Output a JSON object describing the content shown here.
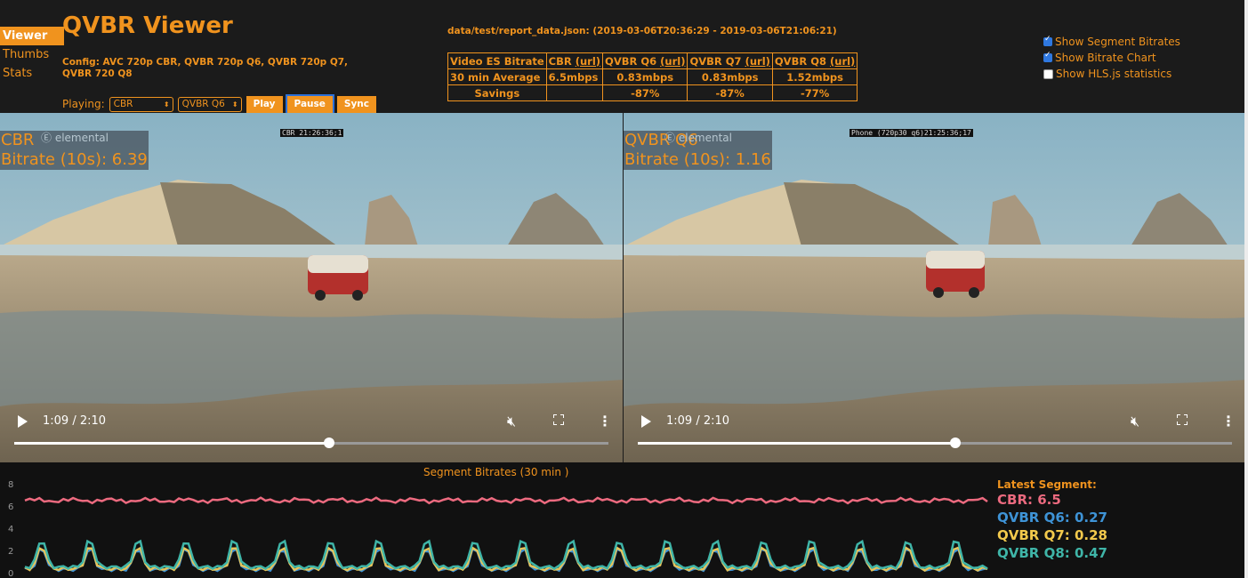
{
  "nav": {
    "items": [
      "Viewer",
      "Thumbs",
      "Stats"
    ],
    "active": 0
  },
  "app_title": "QVBR Viewer",
  "config": "Config: AVC 720p CBR, QVBR 720p Q6, QVBR 720p Q7, QVBR 720 Q8",
  "playing": {
    "label": "Playing:",
    "left_select": "CBR",
    "right_select": "QVBR Q6",
    "play": "Play",
    "pause": "Pause",
    "sync": "Sync"
  },
  "data_file": "data/test/report_data.json: (2019-03-06T20:36:29 - 2019-03-06T21:06:21)",
  "stats_table": {
    "header": [
      "Video ES Bitrate",
      "CBR",
      "QVBR Q6",
      "QVBR Q7",
      "QVBR Q8"
    ],
    "url_label": "(url)",
    "rows": [
      [
        "30 min Average",
        "6.5mbps",
        "0.83mbps",
        "0.83mbps",
        "1.52mbps"
      ],
      [
        "Savings",
        "",
        "-87%",
        "-87%",
        "-77%"
      ]
    ]
  },
  "checkboxes": [
    {
      "label": "Show Segment Bitrates",
      "checked": true
    },
    {
      "label": "Show Bitrate Chart",
      "checked": true
    },
    {
      "label": "Show HLS.js statistics",
      "checked": false
    }
  ],
  "players": [
    {
      "name": "CBR",
      "bitrate_label": "Bitrate (10s): 6.39",
      "watermark": "elemental",
      "timestamp": "CBR 21:26:36;1",
      "time": "1:09 / 2:10",
      "progress": 0.53
    },
    {
      "name": "QVBR Q6",
      "bitrate_label": "Bitrate (10s): 1.16",
      "watermark": "elemental",
      "timestamp": "Phone (720p30 q6)21:25:36;17",
      "time": "1:09 / 2:10",
      "progress": 0.535
    }
  ],
  "chart_data": {
    "type": "line",
    "title": "Segment Bitrates (30 min )",
    "xlabel": "",
    "ylabel": "",
    "ylim": [
      0,
      8
    ],
    "yticks": [
      0,
      2,
      4,
      6,
      8
    ],
    "series": [
      {
        "name": "CBR",
        "color": "#ec6a7f",
        "pattern": "flat",
        "base": 6.5,
        "amp": 0.25
      },
      {
        "name": "QVBR Q6",
        "color": "#3e93d6",
        "pattern": "spike",
        "base": 0.3,
        "amp": 2.0
      },
      {
        "name": "QVBR Q7",
        "color": "#e7c45a",
        "pattern": "spike",
        "base": 0.35,
        "amp": 2.1
      },
      {
        "name": "QVBR Q8",
        "color": "#3fb5a8",
        "pattern": "spike",
        "base": 0.5,
        "amp": 2.6
      }
    ],
    "cycles": 20,
    "points_per_cycle": 10
  },
  "latest": {
    "header": "Latest Segment:",
    "rows": [
      {
        "label": "CBR: 6.5",
        "color": "#ec6a7f"
      },
      {
        "label": "QVBR Q6: 0.27",
        "color": "#3e93d6"
      },
      {
        "label": "QVBR Q7: 0.28",
        "color": "#f2c94c"
      },
      {
        "label": "QVBR Q8: 0.47",
        "color": "#3fb5a8"
      }
    ]
  }
}
